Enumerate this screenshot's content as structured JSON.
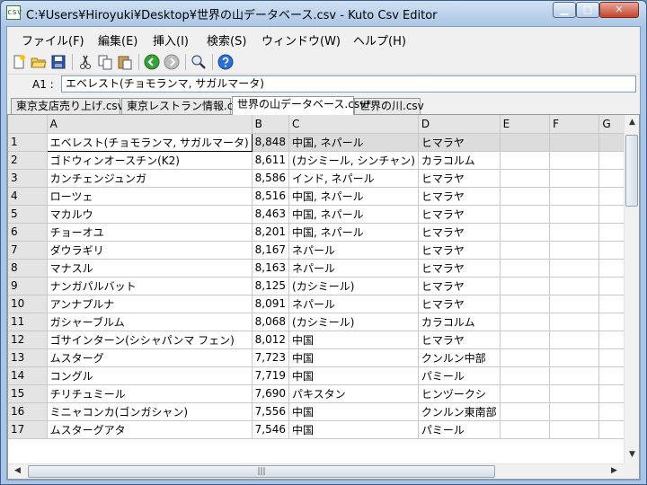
{
  "window": {
    "title": "C:¥Users¥Hiroyuki¥Desktop¥世界の山データベース.csv - Kuto Csv Editor",
    "app_icon_glyph": "csv",
    "min_glyph": "▁",
    "max_glyph": "□",
    "close_glyph": "✕"
  },
  "menu": [
    {
      "label": "ファイル(F)"
    },
    {
      "label": "編集(E)"
    },
    {
      "label": "挿入(I)"
    },
    {
      "label": "検索(S)"
    },
    {
      "label": "ウィンドウ(W)"
    },
    {
      "label": "ヘルプ(H)"
    }
  ],
  "toolbar": [
    {
      "icon": "new-file-icon"
    },
    {
      "icon": "open-folder-icon"
    },
    {
      "icon": "save-icon"
    },
    {
      "icon": "cut-icon"
    },
    {
      "icon": "copy-icon"
    },
    {
      "icon": "paste-icon"
    },
    {
      "icon": "undo-icon"
    },
    {
      "icon": "redo-icon"
    },
    {
      "icon": "search-icon"
    },
    {
      "icon": "help-icon"
    }
  ],
  "formula_bar": {
    "cell_ref": "A1 :",
    "value": "エベレスト(チョモランマ, サガルマータ)"
  },
  "tabs": [
    {
      "label": "東京支店売り上げ.csv",
      "active": false
    },
    {
      "label": "東京レストラン情報.csv",
      "active": false
    },
    {
      "label": "世界の山データベース.csv*",
      "active": true
    },
    {
      "label": "世界の川.csv",
      "active": false
    }
  ],
  "grid": {
    "columns": [
      "A",
      "B",
      "C",
      "D",
      "E",
      "F",
      "G"
    ],
    "rows": [
      {
        "n": "1",
        "cells": [
          "エベレスト(チョモランマ, サガルマータ)",
          "8,848",
          "中国, ネパール",
          "ヒマラヤ"
        ]
      },
      {
        "n": "2",
        "cells": [
          "ゴドウィンオースチン(K2)",
          "8,611",
          "(カシミール, シンチャン)",
          "カラコルム"
        ]
      },
      {
        "n": "3",
        "cells": [
          "カンチェンジュンガ",
          "8,586",
          "インド, ネパール",
          "ヒマラヤ"
        ]
      },
      {
        "n": "4",
        "cells": [
          "ローツェ",
          "8,516",
          "中国, ネパール",
          "ヒマラヤ"
        ]
      },
      {
        "n": "5",
        "cells": [
          "マカルウ",
          "8,463",
          "中国, ネパール",
          "ヒマラヤ"
        ]
      },
      {
        "n": "6",
        "cells": [
          "チョーオユ",
          "8,201",
          "中国, ネパール",
          "ヒマラヤ"
        ]
      },
      {
        "n": "7",
        "cells": [
          "ダウラギリ",
          "8,167",
          "ネパール",
          "ヒマラヤ"
        ]
      },
      {
        "n": "8",
        "cells": [
          "マナスル",
          "8,163",
          "ネパール",
          "ヒマラヤ"
        ]
      },
      {
        "n": "9",
        "cells": [
          "ナンガパルバット",
          "8,125",
          "(カシミール)",
          "ヒマラヤ"
        ]
      },
      {
        "n": "10",
        "cells": [
          "アンナプルナ",
          "8,091",
          "ネパール",
          "ヒマラヤ"
        ]
      },
      {
        "n": "11",
        "cells": [
          "ガシャーブルム",
          "8,068",
          "(カシミール)",
          "カラコルム"
        ]
      },
      {
        "n": "12",
        "cells": [
          "ゴサインターン(シシャパンマ フェン)",
          "8,012",
          "中国",
          "ヒマラヤ"
        ]
      },
      {
        "n": "13",
        "cells": [
          "ムスターグ",
          "7,723",
          "中国",
          "クンルン中部"
        ]
      },
      {
        "n": "14",
        "cells": [
          "コングル",
          "7,719",
          "中国",
          "パミール"
        ]
      },
      {
        "n": "15",
        "cells": [
          "チリチュミール",
          "7,690",
          "パキスタン",
          "ヒンヅークシ"
        ]
      },
      {
        "n": "16",
        "cells": [
          "ミニャコンカ(ゴンガシャン)",
          "7,556",
          "中国",
          "クンルン東南部"
        ]
      },
      {
        "n": "17",
        "cells": [
          "ムスターグアタ",
          "7,546",
          "中国",
          "パミール"
        ]
      }
    ]
  },
  "scrollbars": {
    "up": "▲",
    "down": "▼",
    "left": "◀",
    "right": "▶",
    "grip": "|||"
  }
}
